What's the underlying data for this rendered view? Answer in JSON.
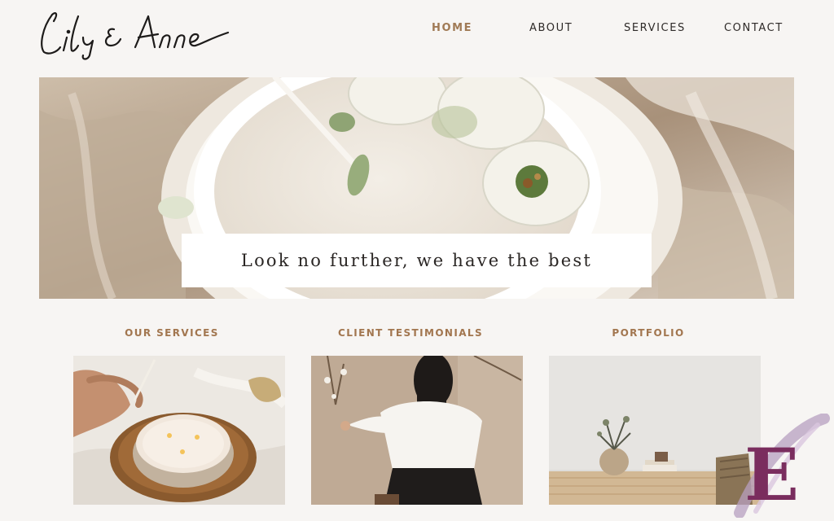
{
  "brand": {
    "logo_text": "Lily & Anne"
  },
  "nav": {
    "items": [
      {
        "label": "HOME",
        "active": true
      },
      {
        "label": "ABOUT",
        "active": false
      },
      {
        "label": "SERVICES",
        "active": false
      },
      {
        "label": "CONTACT",
        "active": false
      }
    ]
  },
  "hero": {
    "caption": "Look no further, we have the best"
  },
  "sections": [
    {
      "title": "OUR SERVICES"
    },
    {
      "title": "CLIENT TESTIMONIALS"
    },
    {
      "title": "PORTFOLIO"
    }
  ],
  "badge": {
    "letter": "E"
  },
  "colors": {
    "background": "#f7f5f3",
    "accent": "#a07a55",
    "text": "#2e2a28",
    "badge": "#7a2d5e"
  }
}
